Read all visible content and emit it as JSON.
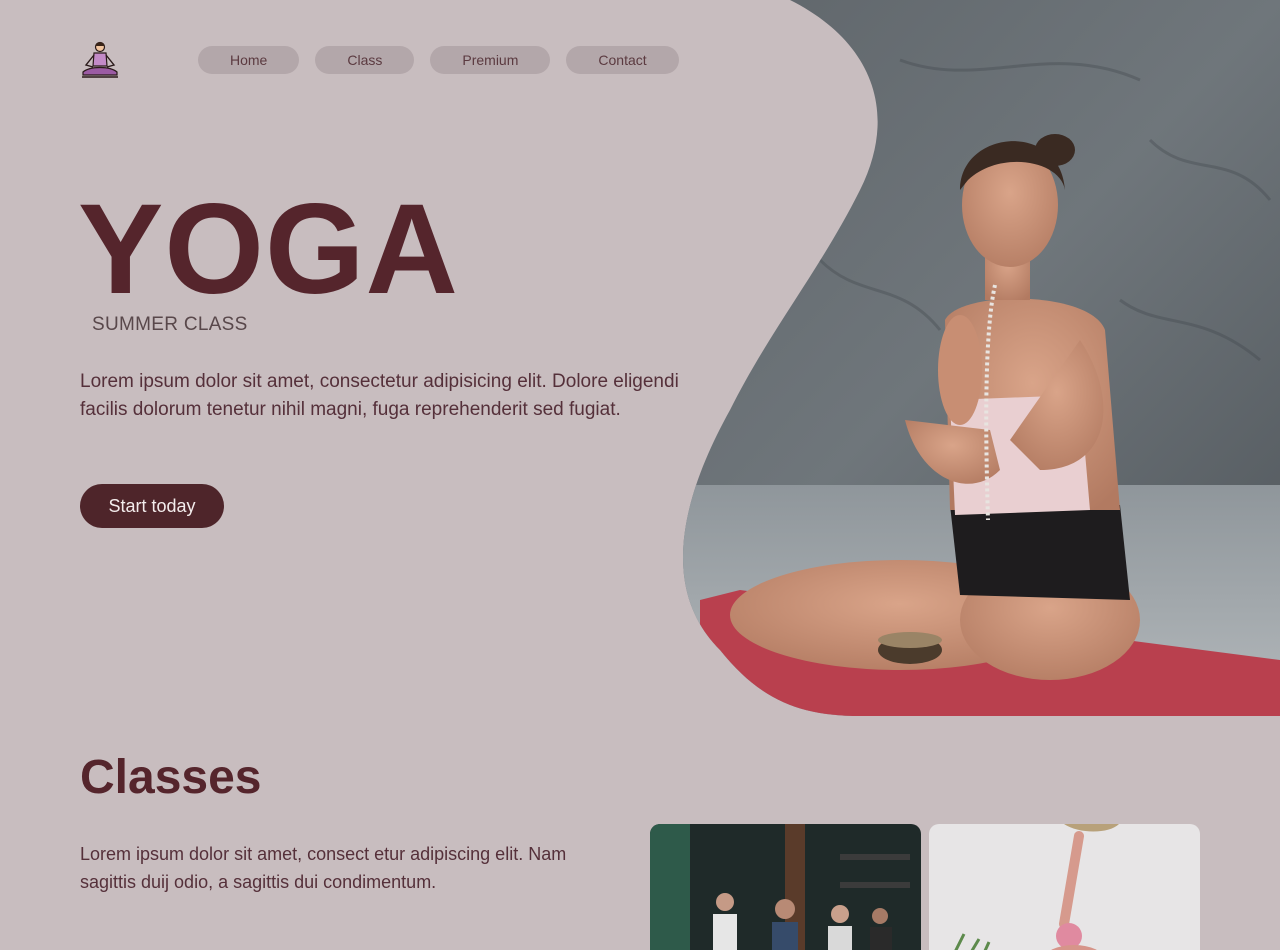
{
  "logo": {
    "icon": "meditation-icon"
  },
  "nav": [
    {
      "label": "Home"
    },
    {
      "label": "Class"
    },
    {
      "label": "Premium"
    },
    {
      "label": "Contact"
    }
  ],
  "hero": {
    "title": "YOGA",
    "subtitle": "SUMMER CLASS",
    "description": "Lorem ipsum dolor sit amet, consectetur adipisicing elit. Dolore eligendi facilis dolorum tenetur nihil magni, fuga reprehenderit sed fugiat.",
    "cta_label": "Start today"
  },
  "classes": {
    "title": "Classes",
    "description": "Lorem ipsum dolor sit amet, consect etur adipiscing elit. Nam sagittis duij odio, a sagittis dui condimentum."
  },
  "colors": {
    "background": "#c8bdbf",
    "accent": "#4e252a",
    "nav_pill": "#b3a7aa",
    "mat": "#b9404e"
  }
}
